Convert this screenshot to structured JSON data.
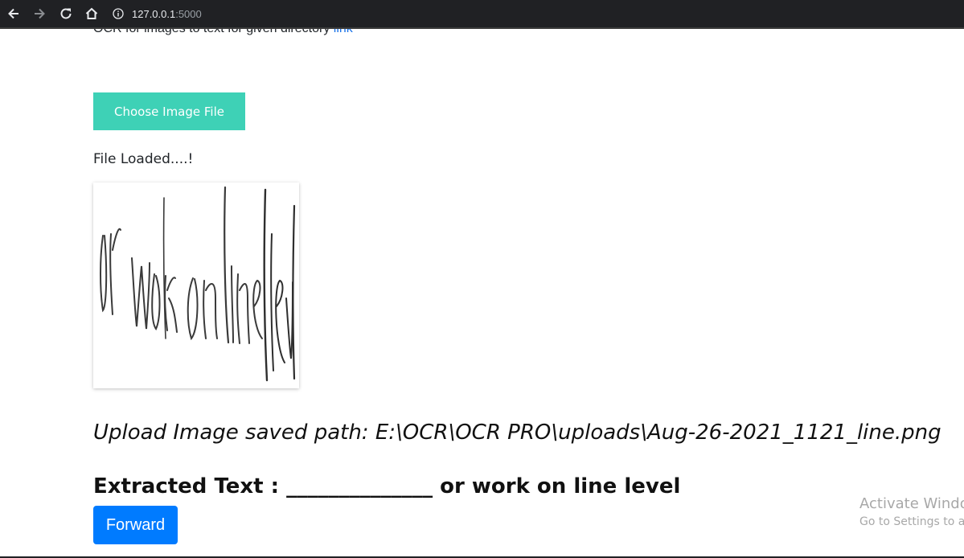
{
  "browser": {
    "url_host": "127.0.0.1",
    "url_port": ":5000",
    "icons": [
      "back-icon",
      "forward-icon",
      "reload-icon",
      "home-icon",
      "info-icon"
    ]
  },
  "page": {
    "cut_text": "OCR for images to text for given directory",
    "cut_link": "link",
    "choose_button": "Choose Image File",
    "file_status": "File Loaded....!",
    "image_text": "or work on line level",
    "saved_path": "Upload Image saved path: E:\\OCR\\OCR PRO\\uploads\\Aug-26-2021_1121_line.png",
    "extracted_text": "Extracted Text : ______________ or work on line level",
    "forward_button": "Forward"
  },
  "watermark": {
    "title": "Activate Windows",
    "subtitle": "Go to Settings to activate Windows."
  },
  "colors": {
    "choose_button_bg": "#3ed1b6",
    "forward_button_bg": "#007bff",
    "browser_bar_bg": "#202124"
  }
}
